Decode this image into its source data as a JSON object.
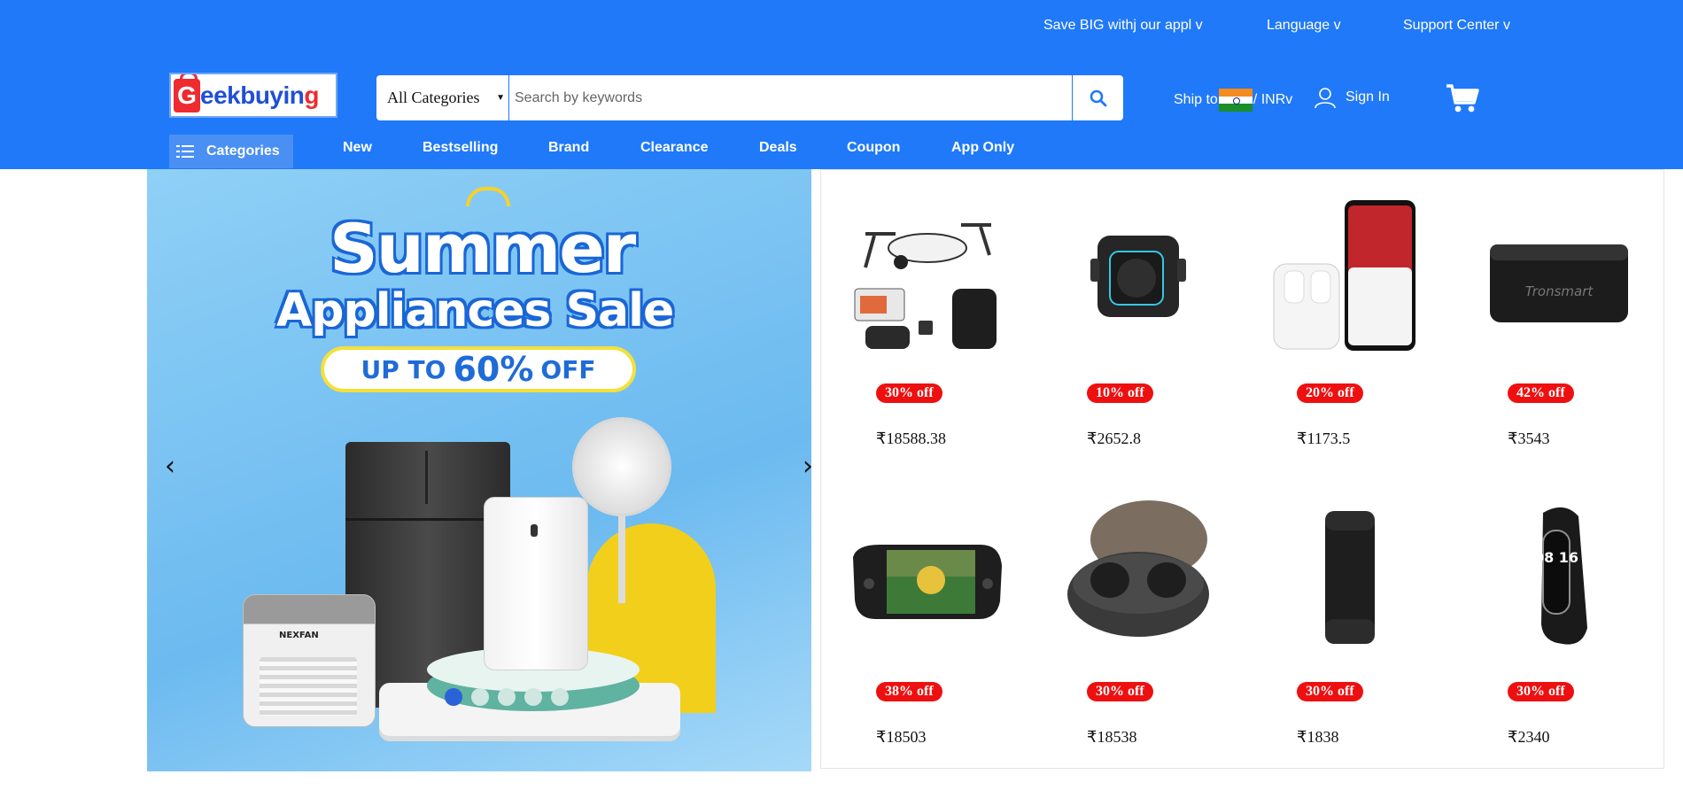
{
  "top_links": {
    "app": "Save BIG withj our appl v",
    "language": "Language v",
    "support": "Support Center v"
  },
  "logo": {
    "prefix": "G",
    "name": "eekbuyin",
    "suffix": "g"
  },
  "search": {
    "category": "All Categories",
    "placeholder": "Search by keywords"
  },
  "ship": {
    "label": "Ship to",
    "currency": "/ INRv"
  },
  "account": {
    "signin": "Sign In"
  },
  "nav": {
    "categories": "Categories",
    "items": [
      "New",
      "Bestselling",
      "Brand",
      "Clearance",
      "Deals",
      "Coupon",
      "App Only"
    ]
  },
  "banner": {
    "title_line1": "Summer",
    "title_line2": "Appliances Sale",
    "pill_prefix": "UP TO",
    "pill_value": "60%",
    "pill_suffix": "OFF",
    "product_brand": "NEXFAN",
    "prev_arrow": "‹",
    "next_arrow": "›",
    "active_slide": 1,
    "slide_count": 5
  },
  "products": [
    {
      "name": "drone",
      "discount": "30% off",
      "price": "₹18588.38"
    },
    {
      "name": "speaker-small",
      "discount": "10% off",
      "price": "₹2652.8"
    },
    {
      "name": "earbuds-phone",
      "discount": "20% off",
      "price": "₹1173.5"
    },
    {
      "name": "speaker-tronsmart",
      "discount": "42% off",
      "price": "₹3543"
    },
    {
      "name": "handheld-pc",
      "discount": "38% off",
      "price": "₹18503"
    },
    {
      "name": "earbuds-case",
      "discount": "30% off",
      "price": "₹18538"
    },
    {
      "name": "speaker-tall",
      "discount": "30% off",
      "price": "₹1838"
    },
    {
      "name": "smart-band",
      "discount": "30% off",
      "price": "₹2340"
    }
  ],
  "product_labels": {
    "tronsmart": "Tronsmart",
    "band_time": "08 16"
  },
  "colors": {
    "header_blue": "#2079f8",
    "discount_red": "#ee1010",
    "logo_red": "#ee2b2f",
    "logo_blue": "#1f4fd6"
  }
}
